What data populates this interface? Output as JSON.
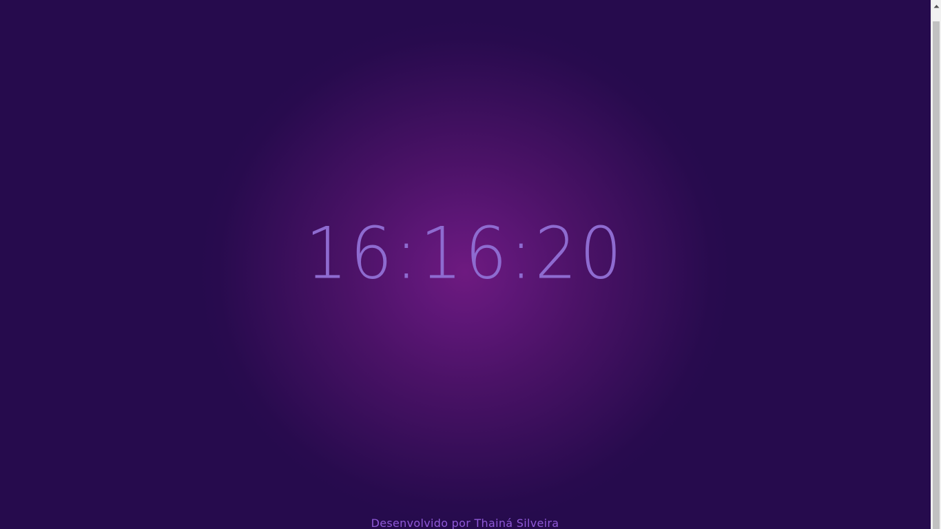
{
  "clock": {
    "time": "16:16:20"
  },
  "footer": {
    "credit": "Desenvolvido por Thainá Silveira"
  },
  "colors": {
    "background_outer": "#260b4d",
    "background_center": "#6e1a80",
    "clock_text": "#8e6bd0",
    "credit_text": "#8e58d6",
    "scrollbar_track": "#f1f1f1",
    "scrollbar_thumb": "#c1c1c1"
  },
  "icons": {
    "scroll_up": "chevron-up-icon"
  }
}
